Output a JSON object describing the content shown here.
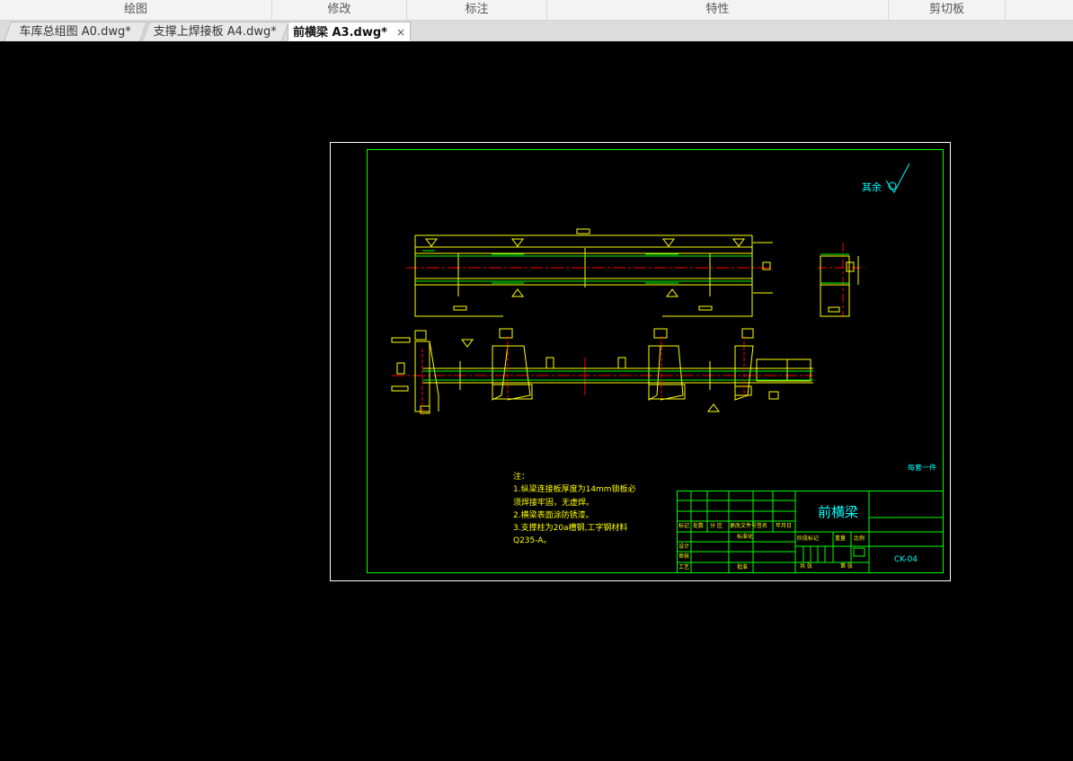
{
  "ribbon": {
    "groups": [
      "绘图",
      "修改",
      "标注",
      "特性",
      "剪切板"
    ]
  },
  "tabs": [
    {
      "label": "车库总组图 A0.dwg*",
      "active": false
    },
    {
      "label": "支撑上焊接板 A4.dwg*",
      "active": false
    },
    {
      "label": "前横梁 A3.dwg*",
      "active": true
    }
  ],
  "close_glyph": "×",
  "drawing": {
    "surface_note": "其余",
    "notes": [
      "注：",
      "1.纵梁连接板厚度为14mm锁板必",
      "须焊接牢固，无虚焊。",
      "2.横梁表面涂防锈漆。",
      "3.支撑柱为20a槽钢,工字钢材料",
      "Q235-A。"
    ],
    "quantity_note": "每套一件",
    "title_block": {
      "part_name": "前横梁",
      "drawing_number": "CK-04",
      "header_cells": [
        "标记",
        "处数",
        "分 区",
        "更改文件号",
        "签名",
        "年月日"
      ],
      "row_labels": [
        "设计",
        "审核",
        "工艺"
      ],
      "row2_mid": "标准化",
      "row4_mid": "批准",
      "stage_label": "阶段标记",
      "weight_label": "重量",
      "scale_label": "比例",
      "sheet_total": "共 张",
      "sheet_no": "第 张"
    },
    "colors": {
      "frame": "#ffffff",
      "border": "#00ff00",
      "geometry": "#ffff00",
      "centerline": "#ff0000",
      "text_cyan": "#00ffff",
      "text_yellow": "#ffff00"
    }
  }
}
